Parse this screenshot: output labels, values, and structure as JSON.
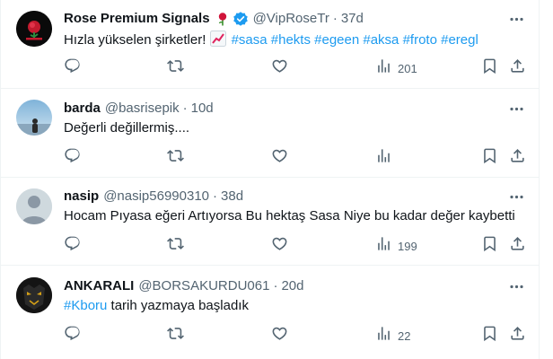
{
  "tweets": [
    {
      "name": "Rose Premium Signals",
      "emoji": "rose-emoji",
      "verified": true,
      "handle": "@VipRoseTr",
      "dot": "·",
      "time": "37d",
      "text_plain": "Hızla yükselen şirketler! ",
      "text_emoji": "chart-increasing-emoji",
      "hashtags": [
        "#sasa",
        "#hekts",
        "#egeen",
        "#aksa",
        "#froto",
        "#eregl"
      ],
      "views": "201"
    },
    {
      "name": "barda",
      "handle": "@basrisepik",
      "dot": "·",
      "time": "10d",
      "text_plain": "Değerli değillermiş....",
      "views": ""
    },
    {
      "name": "nasip",
      "handle": "@nasip56990310",
      "dot": "·",
      "time": "38d",
      "text_plain": "Hocam Pıyasa eğeri Artıyorsa Bu hektaş Sasa Niye bu kadar değer kaybetti",
      "views": "199"
    },
    {
      "name": "ANKARALI",
      "handle": "@BORSAKURDU061",
      "dot": "·",
      "time": "20d",
      "text_tag": "#Kboru",
      "text_plain": " tarih yazmaya başladık",
      "views": "22"
    }
  ],
  "colors": {
    "accent": "#1d9bf0",
    "muted": "#536471",
    "text": "#0f1419",
    "border": "#eff3f4",
    "verified": "#1d9bf0"
  },
  "icons": [
    "reply-icon",
    "retweet-icon",
    "like-icon",
    "views-icon",
    "bookmark-icon",
    "share-icon",
    "more-icon"
  ]
}
